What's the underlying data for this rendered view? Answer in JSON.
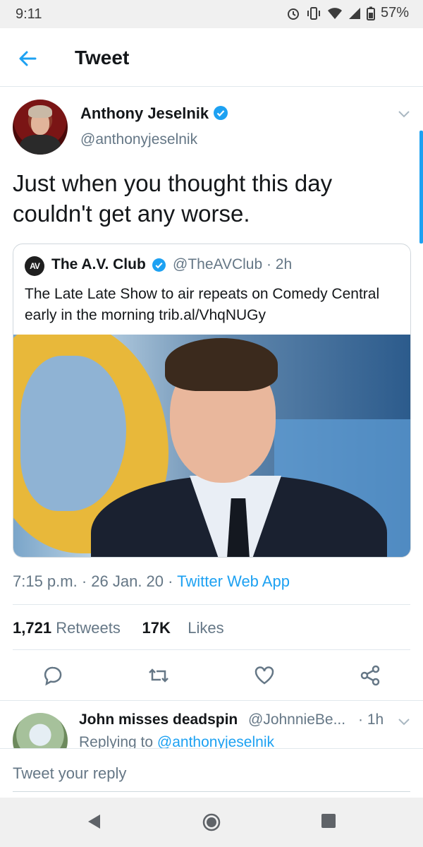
{
  "status_bar": {
    "time": "9:11",
    "battery": "57%"
  },
  "header": {
    "title": "Tweet"
  },
  "tweet": {
    "author_name": "Anthony Jeselnik",
    "handle": "@anthonyjeselnik",
    "text": "Just when you thought this day couldn't get any worse.",
    "quote": {
      "logo_text": "AV",
      "name": "The A.V. Club",
      "handle_time": "@TheAVClub · 2h",
      "text": "The Late Late Show to air repeats on Comedy Central early in the morning trib.al/VhqNUGy"
    },
    "timestamp": "7:15 p.m. · 26 Jan. 20 · ",
    "via": "Twitter Web App",
    "retweets_count": "1,721",
    "retweets_label": "Retweets",
    "likes_count": "17K",
    "likes_label": "Likes"
  },
  "actions": [
    "reply-icon",
    "retweet-icon",
    "like-icon",
    "share-icon"
  ],
  "reply": {
    "name": "John misses deadspin",
    "handle": "@JohnnieBe...",
    "time": "· 1h",
    "replying_prefix": "Replying to ",
    "replying_mention": "@anthonyjeselnik"
  },
  "composer": {
    "placeholder": "Tweet your reply"
  },
  "colors": {
    "accent": "#1da1f2",
    "secondary_text": "#657786",
    "primary_text": "#14171a"
  }
}
